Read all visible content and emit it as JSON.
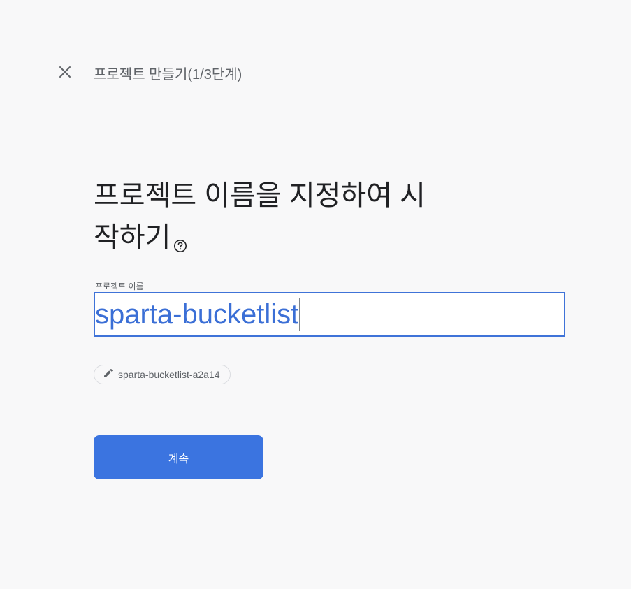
{
  "header": {
    "close_icon": "close-icon",
    "title": "프로젝트 만들기(1/3단계)"
  },
  "main": {
    "heading_line1": "프로젝트 이름을 지정하여 시",
    "heading_line2": "작하기",
    "help_icon": "help-circle-icon"
  },
  "project_name_field": {
    "label": "프로젝트 이름",
    "value": "sparta-bucketlist"
  },
  "project_id_chip": {
    "icon": "edit-pencil-icon",
    "text": "sparta-bucketlist-a2a14"
  },
  "continue_button": {
    "label": "계속"
  },
  "colors": {
    "accent": "#3b74e0",
    "field_border": "#3f73d8",
    "field_text": "#3b6fd6",
    "background": "#f8f8f9"
  }
}
